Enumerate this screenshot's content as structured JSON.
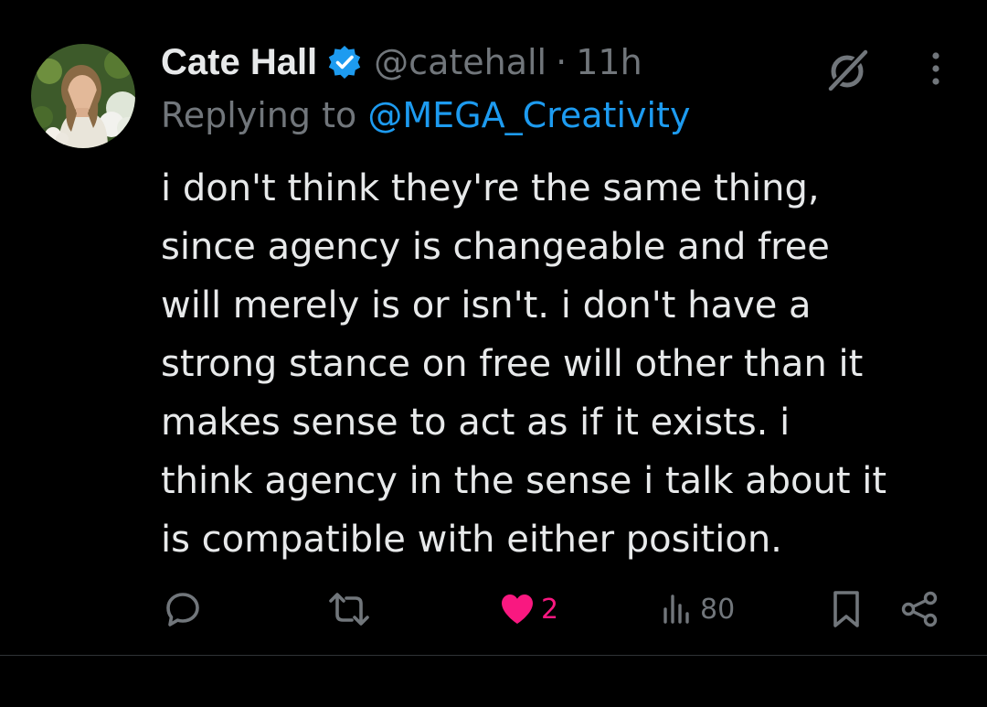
{
  "tweet": {
    "author": {
      "name": "Cate Hall",
      "handle": "@catehall",
      "separator": "·",
      "time": "11h",
      "verified": true
    },
    "reply": {
      "prefix": "Replying to",
      "to": "@MEGA_Creativity"
    },
    "text_lines": [
      "i don't think they're the same thing,",
      "since agency is changeable and free",
      "will merely is or isn't. i don't have a",
      "strong stance on free will other than it",
      "makes sense to act as if it exists. i",
      "think agency in the sense i talk about it",
      "is compatible with either position."
    ],
    "actions": {
      "reply": {
        "icon": "reply-icon"
      },
      "retweet": {
        "icon": "retweet-icon"
      },
      "like": {
        "icon": "heart-icon",
        "count": "2",
        "liked": true
      },
      "views": {
        "icon": "views-icon",
        "count": "80"
      },
      "bookmark": {
        "icon": "bookmark-icon"
      },
      "share": {
        "icon": "share-icon"
      }
    }
  },
  "colors": {
    "background": "#000000",
    "text_primary": "#e7e9ea",
    "text_secondary": "#71767b",
    "accent": "#1d9bf0",
    "like": "#f91880",
    "verified": "#1d9bf0"
  }
}
